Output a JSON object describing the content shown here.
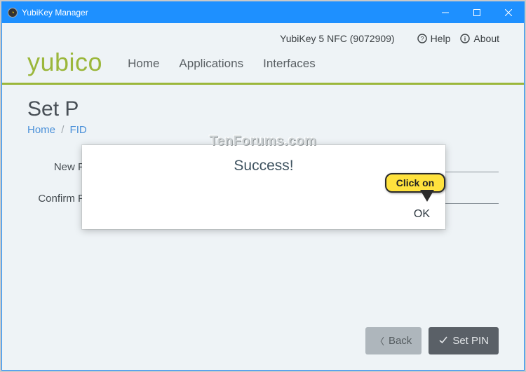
{
  "window": {
    "title": "YubiKey Manager"
  },
  "topbar": {
    "device": "YubiKey 5 NFC (9072909)",
    "help": "Help",
    "about": "About"
  },
  "brand": "yubico",
  "nav": {
    "home": "Home",
    "apps": "Applications",
    "interfaces": "Interfaces"
  },
  "page": {
    "title_visible": "Set P",
    "crumb_home": "Home",
    "crumb_sep": "/",
    "crumb_next_visible": "FID"
  },
  "fields": {
    "new_pin_label": "New PIN",
    "new_pin_mask": "••••",
    "confirm_pin_label": "Confirm PIN",
    "confirm_pin_mask": "••••"
  },
  "footer": {
    "back": "Back",
    "setpin": "Set PIN"
  },
  "modal": {
    "title": "Success!",
    "ok": "OK"
  },
  "callout": {
    "text": "Click on"
  },
  "watermark": "TenForums.com"
}
